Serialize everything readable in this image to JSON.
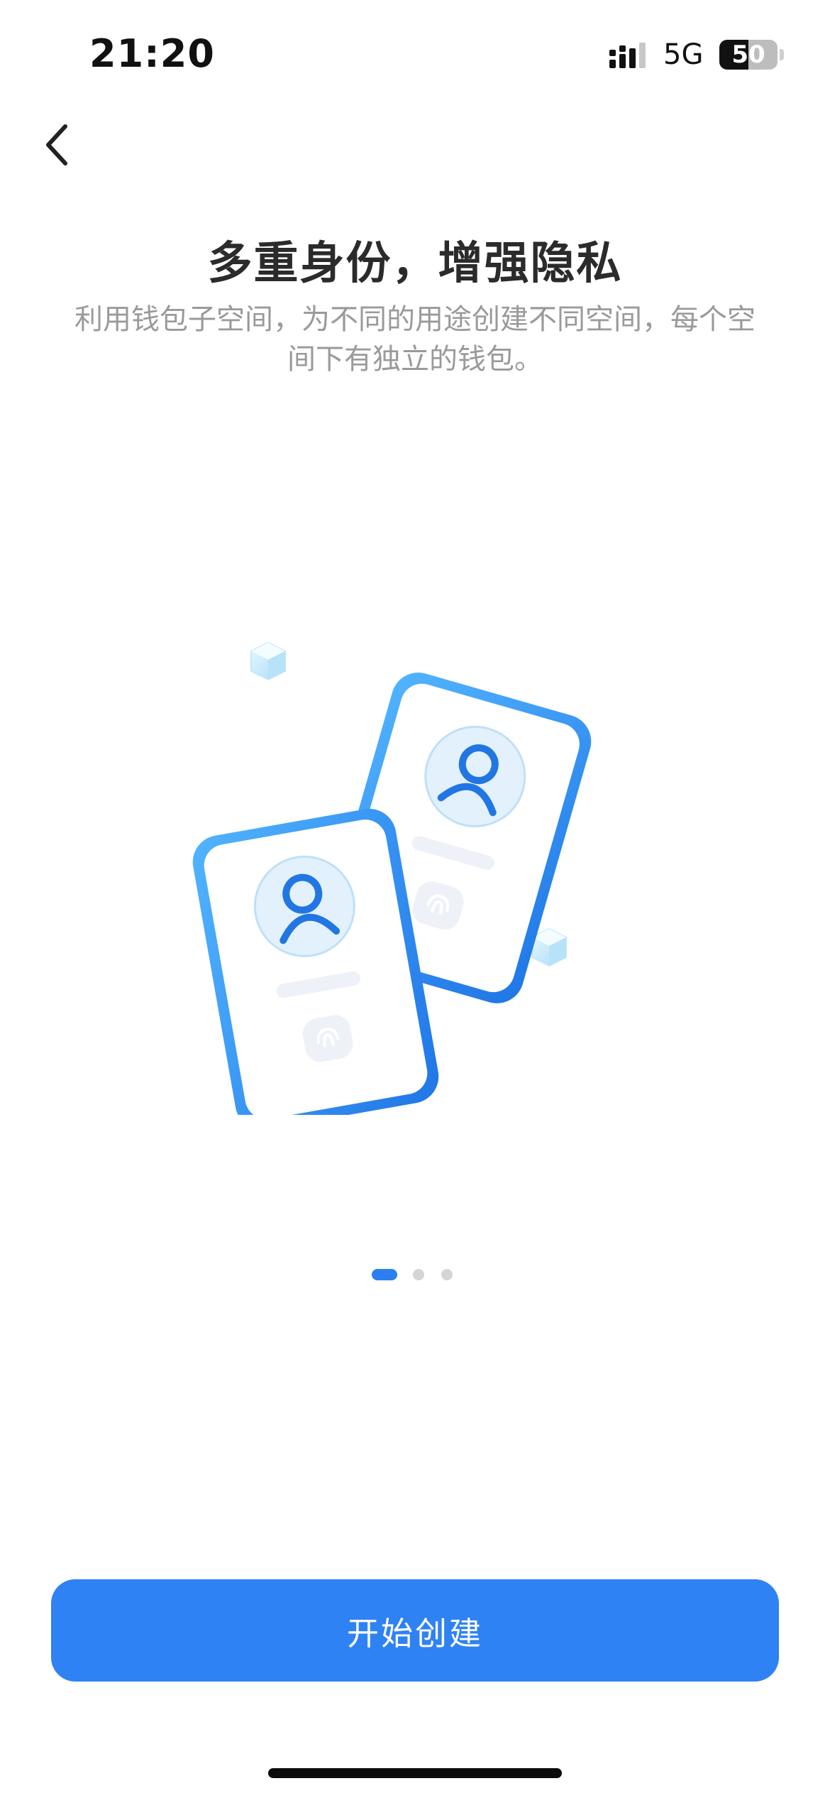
{
  "status_bar": {
    "time": "21:20",
    "network": "5G",
    "battery": "50",
    "signal_icon": "signal-bars-icon"
  },
  "nav": {
    "back_icon": "chevron-left-icon"
  },
  "onboarding": {
    "title": "多重身份，增强隐私",
    "subtitle": "利用钱包子空间，为不同的用途创建不同空间，每个空间下有独立的钱包。",
    "illustration_icons": [
      "phone-icon",
      "user-icon",
      "fingerprint-icon",
      "cube-icon"
    ],
    "accent_color": "#2f82f4",
    "pager": {
      "total": 3,
      "active": 1
    }
  },
  "actions": {
    "start_label": "开始创建"
  }
}
